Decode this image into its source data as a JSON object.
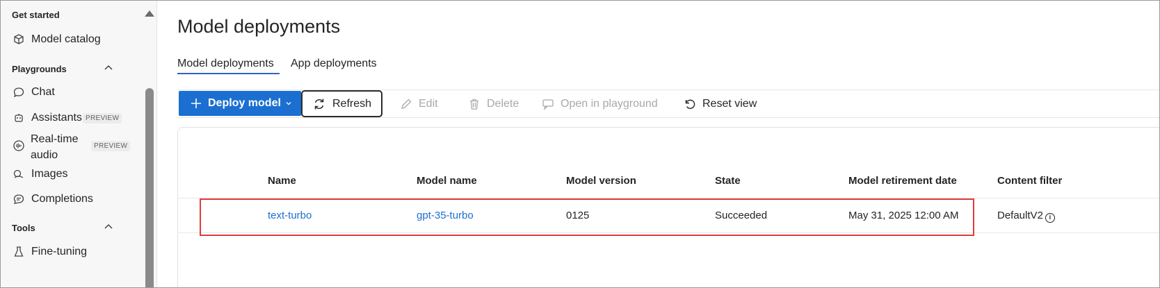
{
  "sidebar": {
    "get_started": "Get started",
    "model_catalog": "Model catalog",
    "playgrounds": "Playgrounds",
    "chat": "Chat",
    "assistants": "Assistants",
    "assistants_badge": "PREVIEW",
    "realtime_line1": "Real-time",
    "realtime_line2": "audio",
    "realtime_badge": "PREVIEW",
    "images": "Images",
    "completions": "Completions",
    "tools": "Tools",
    "fine_tuning": "Fine-tuning"
  },
  "main": {
    "title": "Model deployments",
    "tabs": [
      {
        "label": "Model deployments"
      },
      {
        "label": "App deployments"
      }
    ]
  },
  "toolbar": {
    "deploy_model": "Deploy model",
    "refresh": "Refresh",
    "edit": "Edit",
    "delete": "Delete",
    "open_in_playground": "Open in playground",
    "reset_view": "Reset view"
  },
  "table": {
    "columns": [
      "Name",
      "Model name",
      "Model version",
      "State",
      "Model retirement date",
      "Content filter"
    ],
    "rows": [
      {
        "name": "text-turbo",
        "model_name": "gpt-35-turbo",
        "model_version": "0125",
        "state": "Succeeded",
        "retirement_date": "May 31, 2025 12:00 AM",
        "content_filter": "DefaultV2"
      }
    ]
  },
  "colors": {
    "accent": "#1b6fd0",
    "highlight": "#e23b3b",
    "tab_underline": "#2f63c4"
  }
}
